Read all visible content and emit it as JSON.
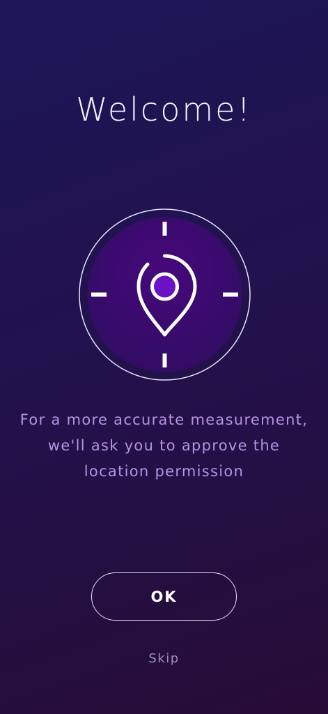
{
  "welcome": {
    "title": "Welcome!"
  },
  "illustration": {
    "icon": "location-pin-icon",
    "colors": {
      "ring": "#e8e4ff",
      "disc": "#3d0a6b",
      "pin_center": "#6a13c4",
      "marks": "#ffffff"
    }
  },
  "message": {
    "lines": [
      "For a more accurate measurement,",
      "we'll ask you to approve the",
      "location permission"
    ]
  },
  "actions": {
    "ok_label": "OK",
    "skip_label": "Skip"
  },
  "theme": {
    "background_start": "#1c1657",
    "background_end": "#270c36",
    "message_color": "#b693e6",
    "skip_color": "#9a93b8"
  }
}
